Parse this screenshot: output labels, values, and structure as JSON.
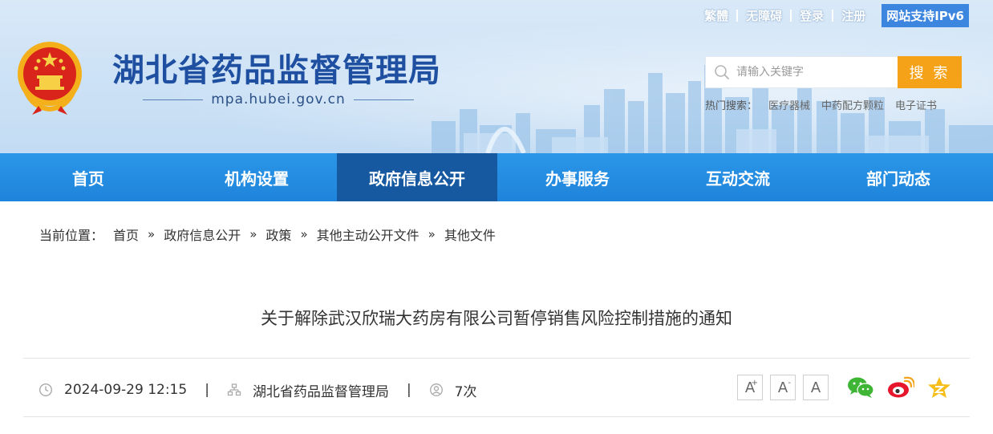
{
  "header": {
    "site_title": "湖北省药品监督管理局",
    "domain": "mpa.hubei.gov.cn",
    "top_links": [
      "繁體",
      "无障碍",
      "登录",
      "注册"
    ],
    "ipv6_label": "网站支持IPv6",
    "search": {
      "placeholder": "请输入关键字",
      "button_label": "搜 索"
    },
    "hot_search": {
      "label": "热门搜索：",
      "items": [
        "医疗器械",
        "中药配方颗粒",
        "电子证书"
      ]
    }
  },
  "nav": {
    "items": [
      "首页",
      "机构设置",
      "政府信息公开",
      "办事服务",
      "互动交流",
      "部门动态"
    ],
    "active_index": 2
  },
  "breadcrumb": {
    "label": "当前位置：",
    "items": [
      "首页",
      "政府信息公开",
      "政策",
      "其他主动公开文件",
      "其他文件"
    ],
    "separator": "»"
  },
  "article": {
    "title": "关于解除武汉欣瑞大药房有限公司暂停销售风险控制措施的通知",
    "datetime": "2024-09-29 12:15",
    "source": "湖北省药品监督管理局",
    "views": "7次",
    "separator": "|"
  },
  "tools": {
    "font_large": "A",
    "font_large_mark": "+",
    "font_small": "A",
    "font_small_mark": "-",
    "font_default": "A"
  },
  "colors": {
    "nav_bg": "#1e84db",
    "nav_active": "#1759a0",
    "search_button": "#f5a219",
    "title_blue": "#1f4fa0",
    "ipv6_bg": "#3d86e0"
  }
}
